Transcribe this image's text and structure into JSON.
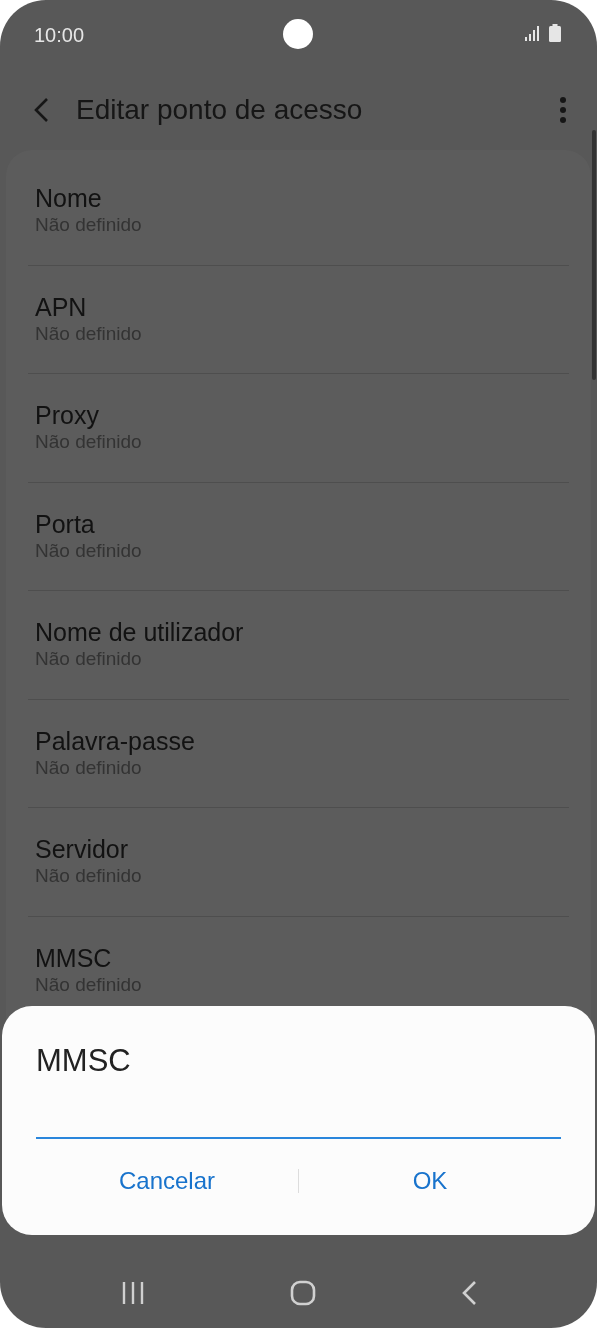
{
  "status_bar": {
    "time": "10:00"
  },
  "header": {
    "title": "Editar ponto de acesso"
  },
  "fields": [
    {
      "label": "Nome",
      "value": "Não definido"
    },
    {
      "label": "APN",
      "value": "Não definido"
    },
    {
      "label": "Proxy",
      "value": "Não definido"
    },
    {
      "label": "Porta",
      "value": "Não definido"
    },
    {
      "label": "Nome de utilizador",
      "value": "Não definido"
    },
    {
      "label": "Palavra-passe",
      "value": "Não definido"
    },
    {
      "label": "Servidor",
      "value": "Não definido"
    },
    {
      "label": "MMSC",
      "value": "Não definido"
    }
  ],
  "dialog": {
    "title": "MMSC",
    "buttons": [
      "Cancelar",
      "OK"
    ]
  }
}
